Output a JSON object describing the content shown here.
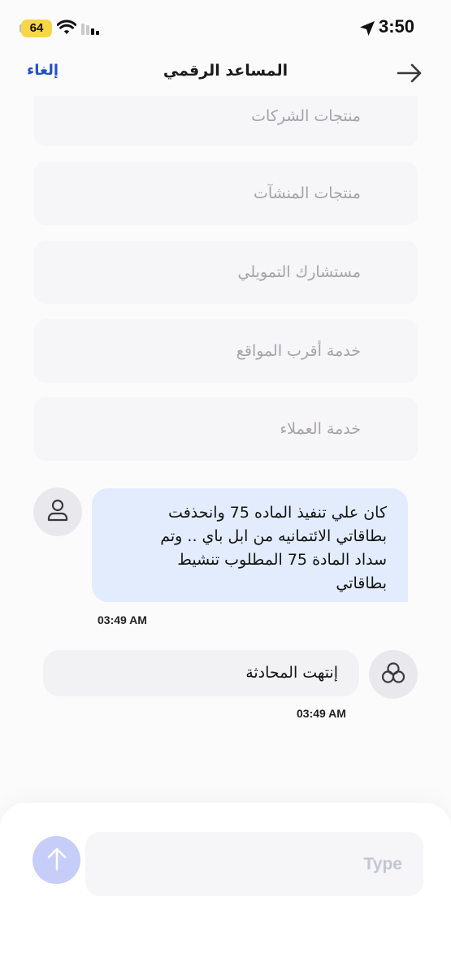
{
  "status_bar": {
    "battery": "64",
    "time": "3:50"
  },
  "header": {
    "cancel_label": "إلغاء",
    "title": "المساعد الرقمي"
  },
  "options": [
    "منتجات الشركات",
    "منتجات المنشآت",
    "مستشارك التمويلي",
    "خدمة أقرب المواقع",
    "خدمة العملاء"
  ],
  "messages": {
    "user": {
      "lines": [
        "كان علي تنفيذ الماده 75 وانحذفت",
        "بطاقاتي الائتمانيه من ابل باي .. وتم",
        "سداد المادة 75 المطلوب تنشيط",
        "بطاقاتي"
      ],
      "time": "03:49 AM"
    },
    "bot": {
      "text": "إنتهت المحادثة",
      "time": "03:49 AM"
    }
  },
  "composer": {
    "placeholder": "Type",
    "value": ""
  },
  "colors": {
    "accent": "#2150c7",
    "user_bubble": "#e2ecfc",
    "send_button": "#c7cdf9",
    "battery": "#f7d64a"
  },
  "icons": {
    "wifi": "wifi-icon",
    "signal": "cellular-signal-icon",
    "location": "location-arrow-icon",
    "back": "arrow-right-icon",
    "user_avatar": "person-icon",
    "bot_avatar": "bot-logo-icon",
    "send": "arrow-up-icon"
  }
}
